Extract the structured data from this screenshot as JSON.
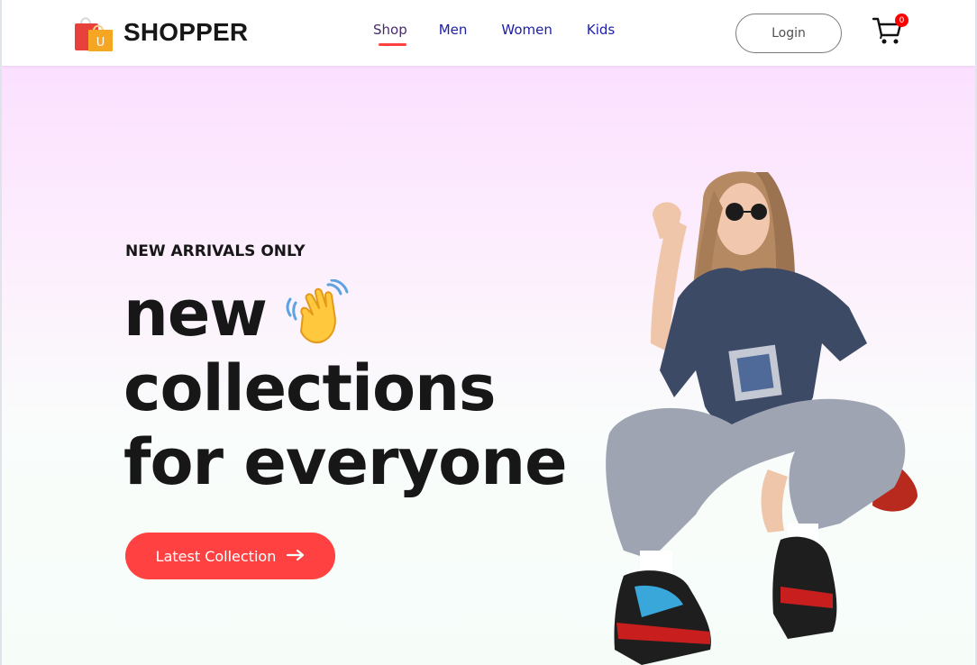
{
  "navbar": {
    "brand": "SHOPPER",
    "logo_icon": "shopping-bag-icon",
    "menu": [
      {
        "label": "Shop",
        "active": true
      },
      {
        "label": "Men",
        "active": false
      },
      {
        "label": "Women",
        "active": false
      },
      {
        "label": "Kids",
        "active": false
      }
    ],
    "login_label": "Login",
    "cart_icon": "cart-icon",
    "cart_count": "0"
  },
  "hero": {
    "tagline": "NEW ARRIVALS ONLY",
    "headline_line1": "new",
    "headline_line2": "collections",
    "headline_line3": "for everyone",
    "wave_icon": "waving-hand-icon",
    "cta_label": "Latest Collection",
    "cta_icon": "arrow-right-icon",
    "image": "hero-model-image"
  },
  "colors": {
    "accent": "#ff4141",
    "nav_link": "#1d1da8",
    "text_dark": "#171717",
    "hero_gradient_top": "#fbe0ff",
    "hero_gradient_bottom": "#f6fdf9"
  }
}
